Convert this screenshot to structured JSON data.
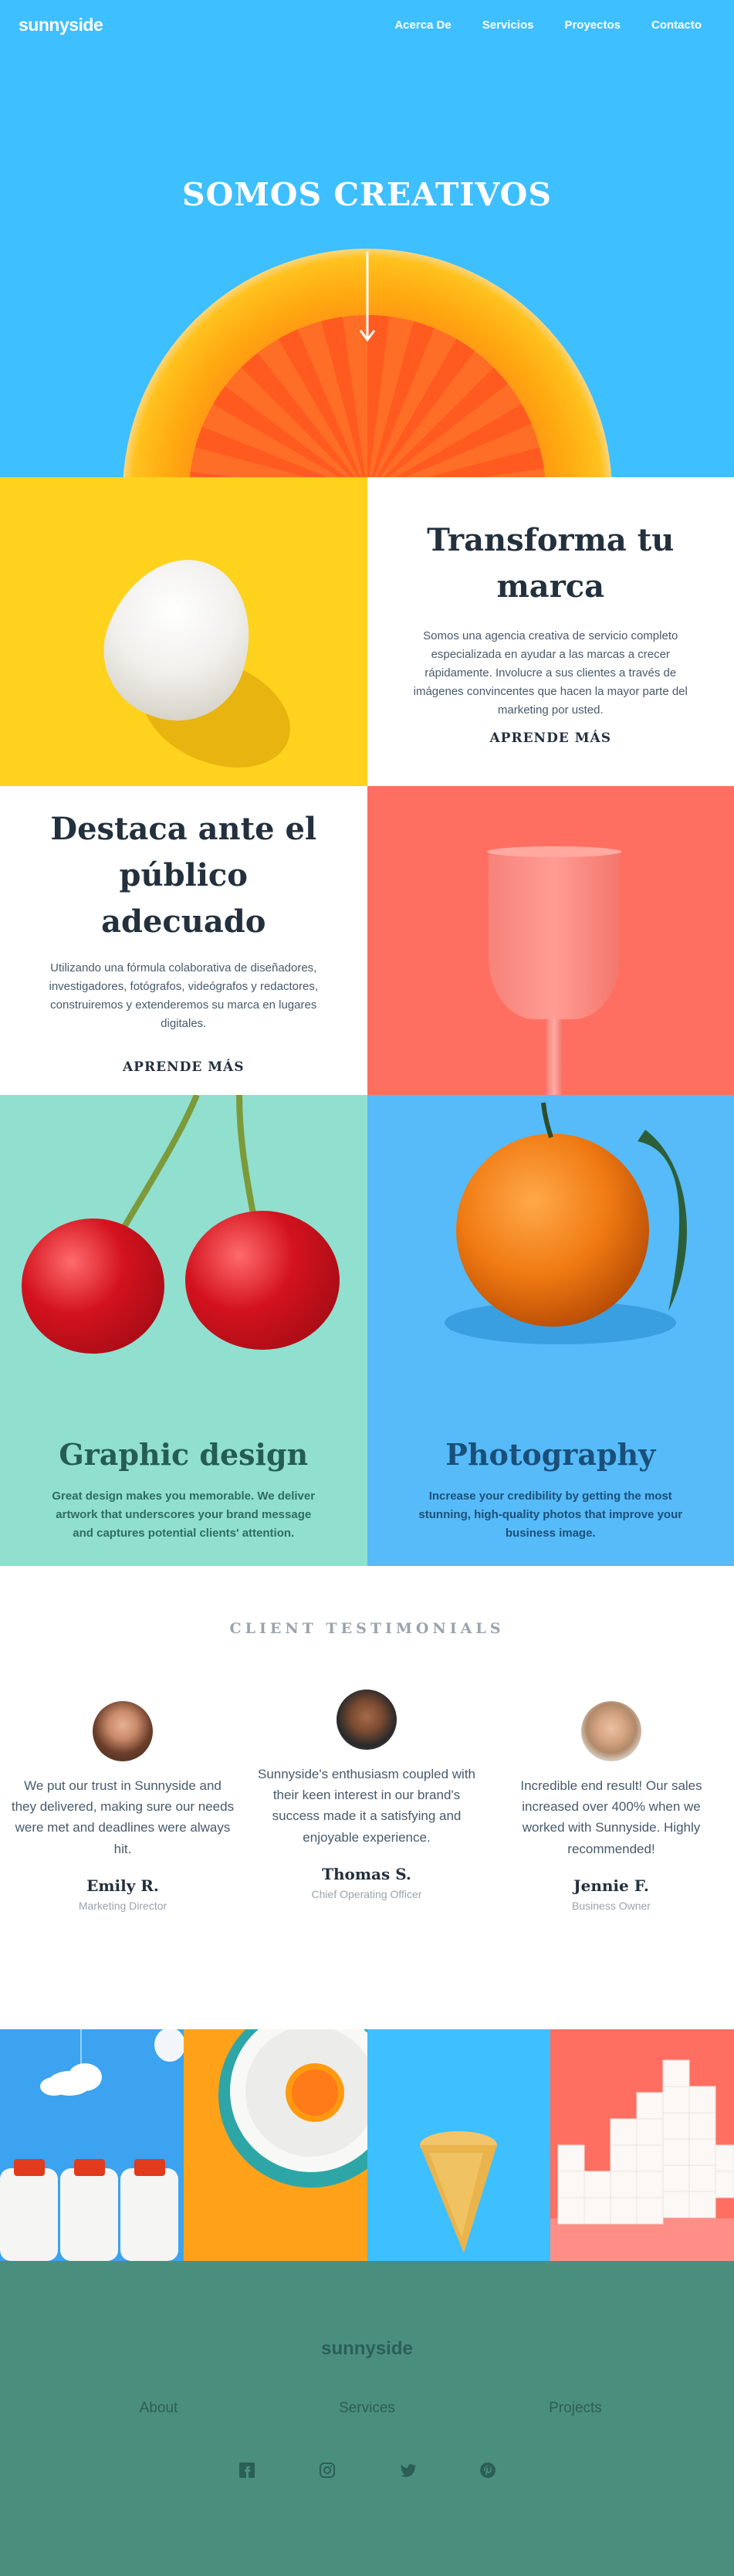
{
  "nav": {
    "logo": "sunnyside",
    "links": [
      "Acerca De",
      "Servicios",
      "Proyectos",
      "Contacto"
    ]
  },
  "hero": {
    "title": "SOMOS CREATIVOS"
  },
  "transform": {
    "title": "Transforma tu marca",
    "body": "Somos una agencia creativa de servicio completo especializada en ayudar a las marcas a crecer rápidamente. Involucre a sus clientes a través de imágenes convincentes que hacen la mayor parte del marketing por usted.",
    "cta": "APRENDE MÁS"
  },
  "standout": {
    "title": "Destaca ante el público adecuado",
    "body": "Utilizando una fórmula colaborativa de diseñadores, investigadores, fotógrafos, videógrafos y redactores, construiremos y extenderemos su marca en lugares digitales.",
    "cta": "APRENDE MÁS"
  },
  "features": [
    {
      "title": "Graphic design",
      "body": "Great design makes you memorable. We deliver artwork that underscores your brand message and captures potential clients' attention."
    },
    {
      "title": "Photography",
      "body": "Increase your credibility by getting the most stunning, high-quality photos that improve your business image."
    }
  ],
  "testimonials": {
    "heading": "CLIENT TESTIMONIALS",
    "items": [
      {
        "quote": "We put our trust in Sunnyside and they delivered, making sure our needs were met and deadlines were always hit.",
        "name": "Emily R.",
        "role": "Marketing Director"
      },
      {
        "quote": "Sunnyside's enthusiasm coupled with their keen interest in our brand's success made it a satisfying and enjoyable experience.",
        "name": "Thomas S.",
        "role": "Chief Operating Officer"
      },
      {
        "quote": "Incredible end result! Our sales increased over 400% when we worked with Sunnyside. Highly recommended!",
        "name": "Jennie F.",
        "role": "Business Owner"
      }
    ]
  },
  "footer": {
    "logo": "sunnyside",
    "links": [
      "About",
      "Services",
      "Projects"
    ],
    "social": [
      "facebook-icon",
      "instagram-icon",
      "twitter-icon",
      "pinterest-icon"
    ]
  },
  "colors": {
    "hero_blue": "#3ebfff",
    "yellow": "#fed21d",
    "coral": "#ff6f61",
    "mint": "#91dfcf",
    "sky": "#56bbf8",
    "footer_green": "#4a8e7e"
  }
}
